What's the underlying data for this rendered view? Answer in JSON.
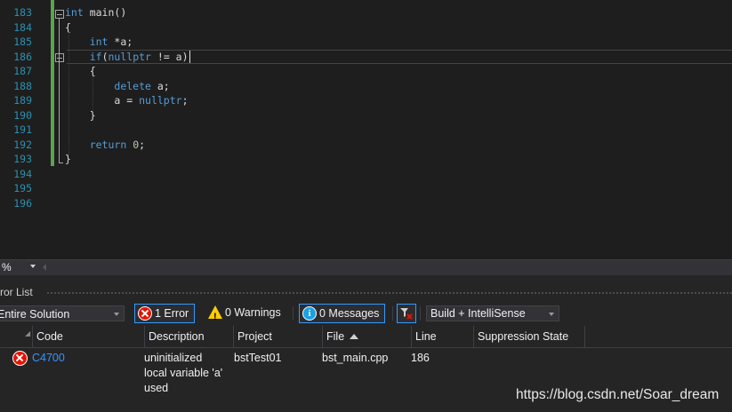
{
  "editor": {
    "lines": [
      {
        "num": "183",
        "code": [
          {
            "t": "kw",
            "v": "int"
          },
          {
            "t": "",
            "v": " main()"
          }
        ]
      },
      {
        "num": "184",
        "code": [
          {
            "t": "",
            "v": "{"
          }
        ]
      },
      {
        "num": "185",
        "code": [
          {
            "t": "",
            "v": "    "
          },
          {
            "t": "kw",
            "v": "int"
          },
          {
            "t": "",
            "v": " *a;"
          }
        ]
      },
      {
        "num": "186",
        "code": [
          {
            "t": "",
            "v": "    "
          },
          {
            "t": "kw",
            "v": "if"
          },
          {
            "t": "",
            "v": "("
          },
          {
            "t": "kw",
            "v": "nullptr"
          },
          {
            "t": "",
            "v": " != a)"
          }
        ]
      },
      {
        "num": "187",
        "code": [
          {
            "t": "",
            "v": "    {"
          }
        ]
      },
      {
        "num": "188",
        "code": [
          {
            "t": "",
            "v": "        "
          },
          {
            "t": "kw",
            "v": "delete"
          },
          {
            "t": "",
            "v": " a;"
          }
        ]
      },
      {
        "num": "189",
        "code": [
          {
            "t": "",
            "v": "        a = "
          },
          {
            "t": "kw",
            "v": "nullptr"
          },
          {
            "t": "",
            "v": ";"
          }
        ]
      },
      {
        "num": "190",
        "code": [
          {
            "t": "",
            "v": "    }"
          }
        ]
      },
      {
        "num": "191",
        "code": []
      },
      {
        "num": "192",
        "code": [
          {
            "t": "",
            "v": "    "
          },
          {
            "t": "kw",
            "v": "return"
          },
          {
            "t": "",
            "v": " "
          },
          {
            "t": "num",
            "v": "0"
          },
          {
            "t": "",
            "v": ";"
          }
        ]
      },
      {
        "num": "193",
        "code": [
          {
            "t": "",
            "v": "}"
          }
        ]
      },
      {
        "num": "194",
        "code": []
      },
      {
        "num": "195",
        "code": []
      },
      {
        "num": "196",
        "code": []
      }
    ],
    "current_line": "186"
  },
  "zoom": {
    "value": "%"
  },
  "error_list": {
    "title": "ror List",
    "scope": "Entire Solution",
    "errors_btn": "1 Error",
    "warnings_btn": "0 Warnings",
    "messages_btn": "0 Messages",
    "build_filter": "Build + IntelliSense",
    "columns": {
      "code": "Code",
      "description": "Description",
      "project": "Project",
      "file": "File",
      "line": "Line",
      "suppression": "Suppression State"
    },
    "rows": [
      {
        "code": "C4700",
        "description": [
          "uninitialized",
          "local variable 'a'",
          "used"
        ],
        "project": "bstTest01",
        "file": "bst_main.cpp",
        "line": "186",
        "suppression": ""
      }
    ]
  },
  "watermark": "https://blog.csdn.net/Soar_dream",
  "colors": {
    "background": "#1e1e1e",
    "keyword": "#569cd6",
    "line_number": "#2b91af",
    "change_bar": "#57a64a",
    "link": "#3794ff",
    "error": "#e51400",
    "accent_border": "#3399ff"
  },
  "icons": [
    "error-icon",
    "warning-icon",
    "info-icon",
    "filter-icon",
    "sort-ascending-icon",
    "fold-icon"
  ]
}
